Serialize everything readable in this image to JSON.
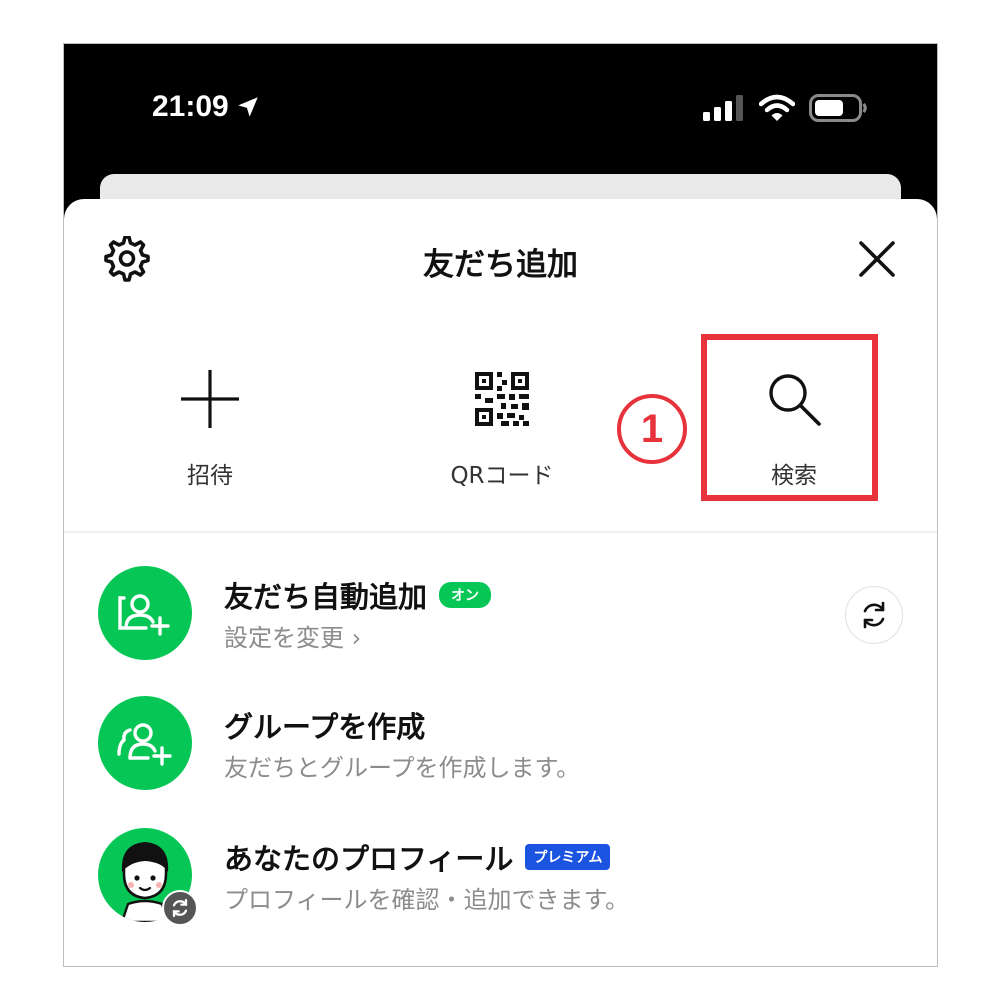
{
  "status_bar": {
    "time": "21:09"
  },
  "sheet": {
    "title": "友だち追加"
  },
  "actions": [
    {
      "label": "招待"
    },
    {
      "label": "QRコード"
    },
    {
      "label": "検索"
    }
  ],
  "annotation": {
    "step": "1",
    "color": "#e8333d"
  },
  "rows": [
    {
      "title": "友だち自動追加",
      "badge": "オン",
      "subtitle": "設定を変更 ›"
    },
    {
      "title": "グループを作成",
      "subtitle": "友だちとグループを作成します。"
    },
    {
      "title": "あなたのプロフィール",
      "badge": "プレミアム",
      "subtitle": "プロフィールを確認・追加できます。"
    }
  ],
  "colors": {
    "line_green": "#06c755",
    "premium_blue": "#1a54e0"
  }
}
